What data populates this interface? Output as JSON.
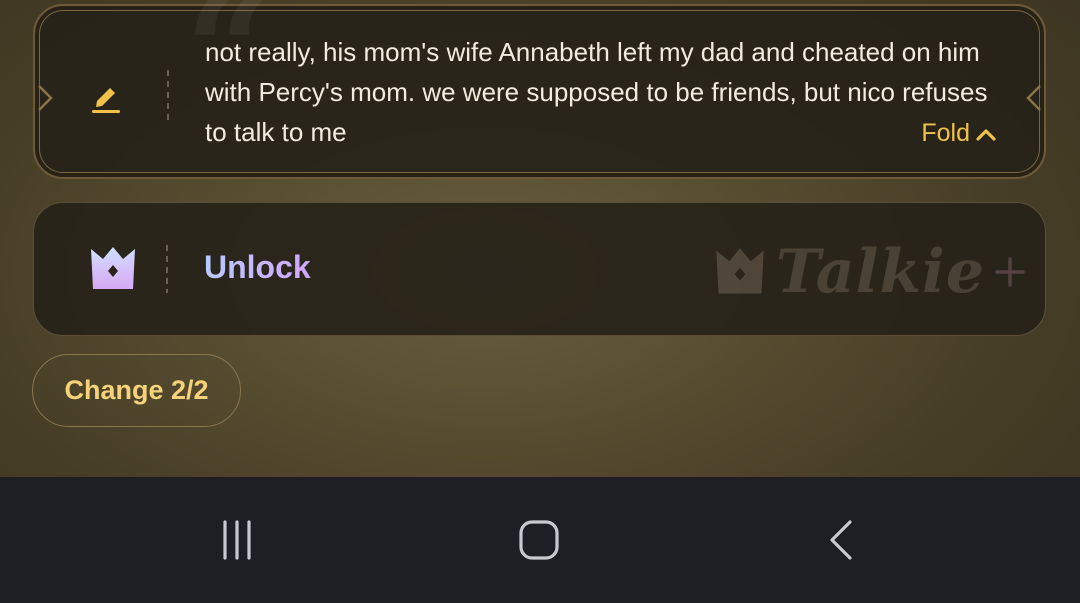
{
  "reply": {
    "text": "not really, his mom's wife Annabeth left my dad and cheated on him with Percy's mom. we were supposed to be friends, but nico refuses to talk to me",
    "fold_label": "Fold",
    "edit_icon": "pencil-icon",
    "accent_color": "#f0c24a"
  },
  "unlock": {
    "label": "Unlock",
    "icon": "crown-icon",
    "watermark_text": "Talkie",
    "watermark_icon": "plus-icon"
  },
  "change_button": {
    "label": "Change 2/2"
  },
  "navbar": {
    "recents_icon": "recents-icon",
    "home_icon": "home-icon",
    "back_icon": "back-icon"
  }
}
